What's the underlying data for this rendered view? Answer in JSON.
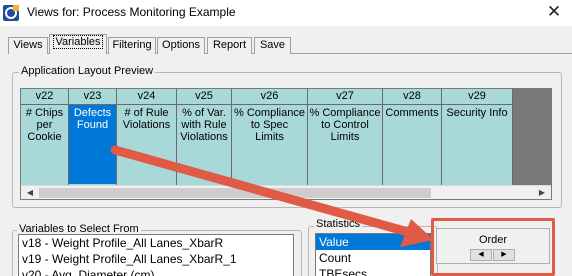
{
  "window": {
    "title": "Views for: Process Monitoring Example",
    "close_symbol": "✕",
    "app_icon": "app-logo-icon"
  },
  "tabs": [
    {
      "label": "Views"
    },
    {
      "label": "Variables",
      "active": true
    },
    {
      "label": "Filtering"
    },
    {
      "label": "Options"
    },
    {
      "label": "Report"
    },
    {
      "label": "Save"
    }
  ],
  "preview": {
    "group_label": "Application Layout Preview",
    "columns": [
      {
        "header": "v22",
        "body": [
          "# Chips",
          "per",
          "Cookie"
        ]
      },
      {
        "header": "v23",
        "body": [
          "Defects",
          "Found"
        ],
        "selected": true
      },
      {
        "header": "v24",
        "body": [
          "# of Rule",
          "Violations"
        ]
      },
      {
        "header": "v25",
        "body": [
          "% of Var.",
          "with Rule",
          "Violations"
        ]
      },
      {
        "header": "v26",
        "body": [
          "% Compliance",
          "to Spec",
          "Limits"
        ]
      },
      {
        "header": "v27",
        "body": [
          "% Compliance",
          "to Control",
          "Limits"
        ]
      },
      {
        "header": "v28",
        "body": [
          "Comments"
        ]
      },
      {
        "header": "v29",
        "body": [
          "Security Info"
        ]
      }
    ],
    "scroll_left": "◀",
    "scroll_right": "▶"
  },
  "variables": {
    "group_label": "Variables to Select From",
    "items": [
      "v18 - Weight Profile_All Lanes_XbarR",
      "v19 - Weight Profile_All Lanes_XbarR_1",
      "v20 - Avg. Diameter  (cm)"
    ]
  },
  "statistics": {
    "group_label": "Statistics",
    "items": [
      "Value",
      "Count",
      "TBEsecs"
    ],
    "selected": "Value"
  },
  "order": {
    "label": "Order",
    "left_symbol": "◀",
    "right_symbol": "▶"
  },
  "annotation": {
    "color": "#e05a45"
  },
  "colors": {
    "column_bg": "#a8d8d8",
    "selection": "#0078d7",
    "filler": "#787878"
  }
}
